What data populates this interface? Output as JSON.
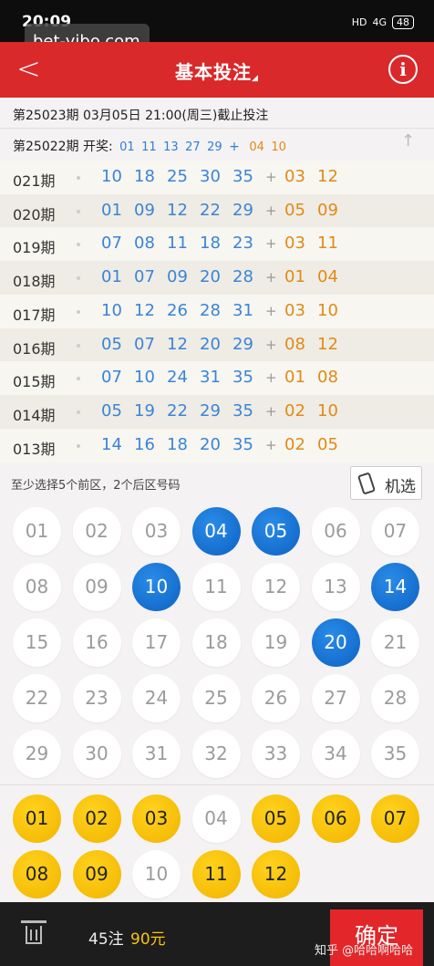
{
  "status_bar": {
    "time": "20:09",
    "hd": "HD",
    "signal": "4G",
    "battery": "48"
  },
  "watermark": "bet-yibo.com",
  "header": {
    "back": "<",
    "title": "基本投注",
    "title_arrow": "◢",
    "info": "i"
  },
  "deadline": "第25023期  03月05日 21:00(周三)截止投注",
  "last_draw": {
    "label": "第25022期 开奖:",
    "front": [
      "01",
      "11",
      "13",
      "27",
      "29"
    ],
    "plus": "+",
    "back": [
      "04",
      "10"
    ]
  },
  "history": [
    {
      "period": "021期",
      "front": [
        "10",
        "18",
        "25",
        "30",
        "35"
      ],
      "back": [
        "03",
        "12"
      ]
    },
    {
      "period": "020期",
      "front": [
        "01",
        "09",
        "12",
        "22",
        "29"
      ],
      "back": [
        "05",
        "09"
      ]
    },
    {
      "period": "019期",
      "front": [
        "07",
        "08",
        "11",
        "18",
        "23"
      ],
      "back": [
        "03",
        "11"
      ]
    },
    {
      "period": "018期",
      "front": [
        "01",
        "07",
        "09",
        "20",
        "28"
      ],
      "back": [
        "01",
        "04"
      ]
    },
    {
      "period": "017期",
      "front": [
        "10",
        "12",
        "26",
        "28",
        "31"
      ],
      "back": [
        "03",
        "10"
      ]
    },
    {
      "period": "016期",
      "front": [
        "05",
        "07",
        "12",
        "20",
        "29"
      ],
      "back": [
        "08",
        "12"
      ]
    },
    {
      "period": "015期",
      "front": [
        "07",
        "10",
        "24",
        "31",
        "35"
      ],
      "back": [
        "01",
        "08"
      ]
    },
    {
      "period": "014期",
      "front": [
        "05",
        "19",
        "22",
        "29",
        "35"
      ],
      "back": [
        "02",
        "10"
      ]
    },
    {
      "period": "013期",
      "front": [
        "14",
        "16",
        "18",
        "20",
        "35"
      ],
      "back": [
        "02",
        "05"
      ]
    }
  ],
  "prompt": "至少选择5个前区，2个后区号码",
  "machine_pick": "机选",
  "front_zone": {
    "numbers": [
      "01",
      "02",
      "03",
      "04",
      "05",
      "06",
      "07",
      "08",
      "09",
      "10",
      "11",
      "12",
      "13",
      "14",
      "15",
      "16",
      "17",
      "18",
      "19",
      "20",
      "21",
      "22",
      "23",
      "24",
      "25",
      "26",
      "27",
      "28",
      "29",
      "30",
      "31",
      "32",
      "33",
      "34",
      "35"
    ],
    "selected": [
      "04",
      "05",
      "10",
      "14",
      "20"
    ]
  },
  "back_zone": {
    "numbers": [
      "01",
      "02",
      "03",
      "04",
      "05",
      "06",
      "07",
      "08",
      "09",
      "10",
      "11",
      "12"
    ],
    "selected": [
      "01",
      "02",
      "03",
      "05",
      "06",
      "07",
      "08",
      "09",
      "11",
      "12"
    ]
  },
  "footer": {
    "bets": "45注",
    "amount": "90元",
    "confirm": "确定",
    "watermark": "知乎 @哈哈啊哈哈"
  },
  "colors": {
    "header": "#d9292a",
    "front_selected": "#0d62c4",
    "back_selected": "#f1b400",
    "front_text": "#3b84d6",
    "back_text": "#e08a17",
    "confirm": "#e3262a"
  }
}
